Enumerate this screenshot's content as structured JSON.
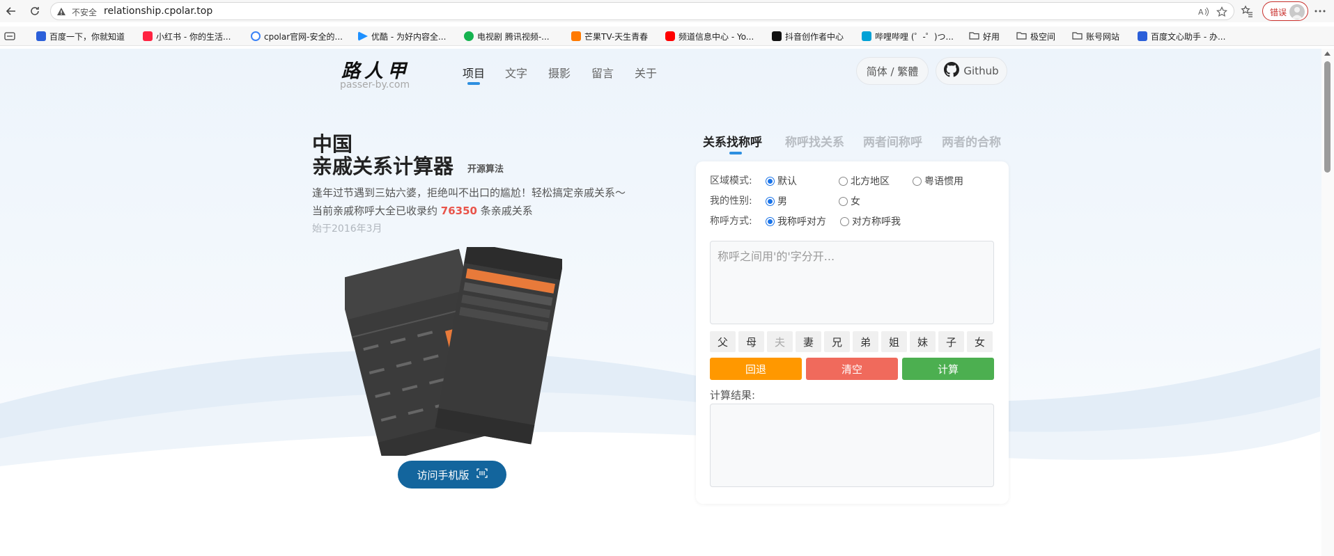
{
  "browser": {
    "insecure_label": "不安全",
    "url": "relationship.cpolar.top",
    "error_label": "错误",
    "bookmarks": [
      {
        "label": "百度一下，你就知道",
        "color": "#2b5fd9"
      },
      {
        "label": "小红书 - 你的生活...",
        "color": "#ff2442"
      },
      {
        "label": "cpolar官网-安全的...",
        "color": "#3b82f6"
      },
      {
        "label": "优酷 - 为好内容全...",
        "color": "#1e90ff"
      },
      {
        "label": "电视剧 腾讯视频-...",
        "color": "#16b350"
      },
      {
        "label": "芒果TV-天生青春",
        "color": "#ff7a00"
      },
      {
        "label": "频道信息中心 - Yo...",
        "color": "#ff0000"
      },
      {
        "label": "抖音创作者中心",
        "color": "#111111"
      },
      {
        "label": "哔哩哔哩 (゜-゜)つ...",
        "color": "#00a1d6"
      },
      {
        "label": "好用",
        "color": "folder"
      },
      {
        "label": "极空间",
        "color": "folder"
      },
      {
        "label": "账号网站",
        "color": "folder"
      },
      {
        "label": "百度文心助手 - 办...",
        "color": "#2b5fd9"
      }
    ]
  },
  "site": {
    "logo_cn": "路人甲",
    "logo_en": "passer-by.com",
    "nav": [
      "项目",
      "文字",
      "摄影",
      "留言",
      "关于"
    ],
    "lang_button": "简体 / 繁體",
    "github_button": "Github"
  },
  "hero": {
    "title_line1": "中国",
    "title_line2": "亲戚关系计算器",
    "open_source_tag": "开源算法",
    "desc_line1": "逢年过节遇到三姑六婆，拒绝叫不出口的尴尬！轻松搞定亲戚关系～",
    "desc_prefix": "当前亲戚称呼大全已收录约",
    "count": "76350",
    "desc_suffix": "条亲戚关系",
    "since": "始于2016年3月",
    "mobile_button": "访问手机版"
  },
  "calculator": {
    "tabs": [
      "关系找称呼",
      "称呼找关系",
      "两者间称呼",
      "两者的合称"
    ],
    "mode_label": "区域模式:",
    "mode_options": [
      "默认",
      "北方地区",
      "粤语惯用"
    ],
    "gender_label": "我的性别:",
    "gender_options": [
      "男",
      "女"
    ],
    "call_label": "称呼方式:",
    "call_options": [
      "我称呼对方",
      "对方称呼我"
    ],
    "input_placeholder": "称呼之间用'的'字分开...",
    "kin_buttons": [
      "父",
      "母",
      "夫",
      "妻",
      "兄",
      "弟",
      "姐",
      "妹",
      "子",
      "女"
    ],
    "back_label": "回退",
    "clear_label": "清空",
    "calc_label": "计算",
    "result_label": "计算结果:",
    "colors": {
      "back": "#ff9800",
      "clear": "#f06a5c",
      "calc": "#4caf50",
      "accent": "#2d8fe0"
    }
  }
}
